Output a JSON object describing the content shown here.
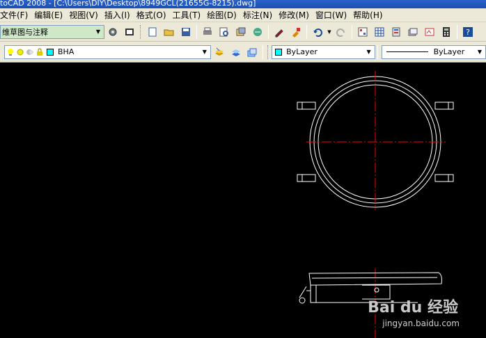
{
  "titlebar": {
    "text": "toCAD 2008 - [C:\\Users\\DIY\\Desktop\\8949GCL(21655G-8215).dwg]"
  },
  "menu": [
    {
      "label": "文件(F)"
    },
    {
      "label": "编辑(E)"
    },
    {
      "label": "视图(V)"
    },
    {
      "label": "插入(I)"
    },
    {
      "label": "格式(O)"
    },
    {
      "label": "工具(T)"
    },
    {
      "label": "绘图(D)"
    },
    {
      "label": "标注(N)"
    },
    {
      "label": "修改(M)"
    },
    {
      "label": "窗口(W)"
    },
    {
      "label": "帮助(H)"
    }
  ],
  "workspace": {
    "value": "维草图与注释"
  },
  "layer": {
    "value": "BHA",
    "color": "#00ffff"
  },
  "color_combo": {
    "value": "ByLayer",
    "color": "#00ffff"
  },
  "linetype_combo": {
    "value": "ByLayer"
  },
  "watermark": {
    "brand": "Bai du 经验",
    "url": "jingyan.baidu.com"
  },
  "colors": {
    "red_centerline": "#ff0000",
    "white_geometry": "#ffffff",
    "cyan": "#00ffff"
  }
}
